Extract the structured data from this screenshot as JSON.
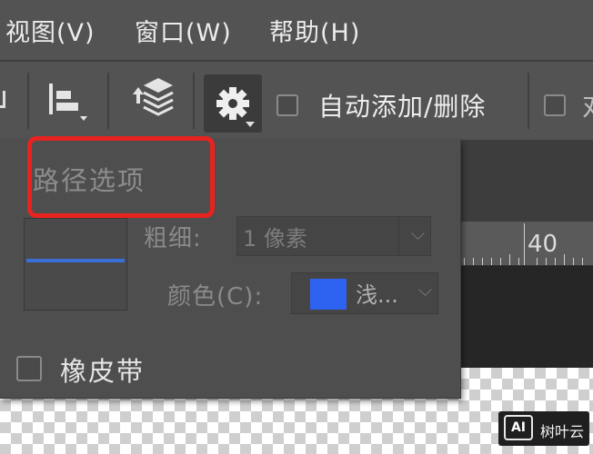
{
  "menu": {
    "view": "视图(V)",
    "window": "窗口(W)",
    "help": "帮助(H)"
  },
  "toolbar": {
    "auto_add_delete_label": "自动添加/删除",
    "auto_add_delete_checked": false
  },
  "path_options": {
    "title": "路径选项",
    "thickness_label": "粗细:",
    "thickness_value": "1 像素",
    "color_label": "颜色(C):",
    "color_value": "浅...",
    "color_swatch": "#2e62f0",
    "rubber_band_label": "橡皮带",
    "rubber_band_checked": false
  },
  "ruler": {
    "mark": "40"
  },
  "watermark": {
    "logo": "AI",
    "text": "树叶云"
  },
  "colors": {
    "highlight_box": "#e6231f",
    "path_line": "#3a6fd8"
  }
}
